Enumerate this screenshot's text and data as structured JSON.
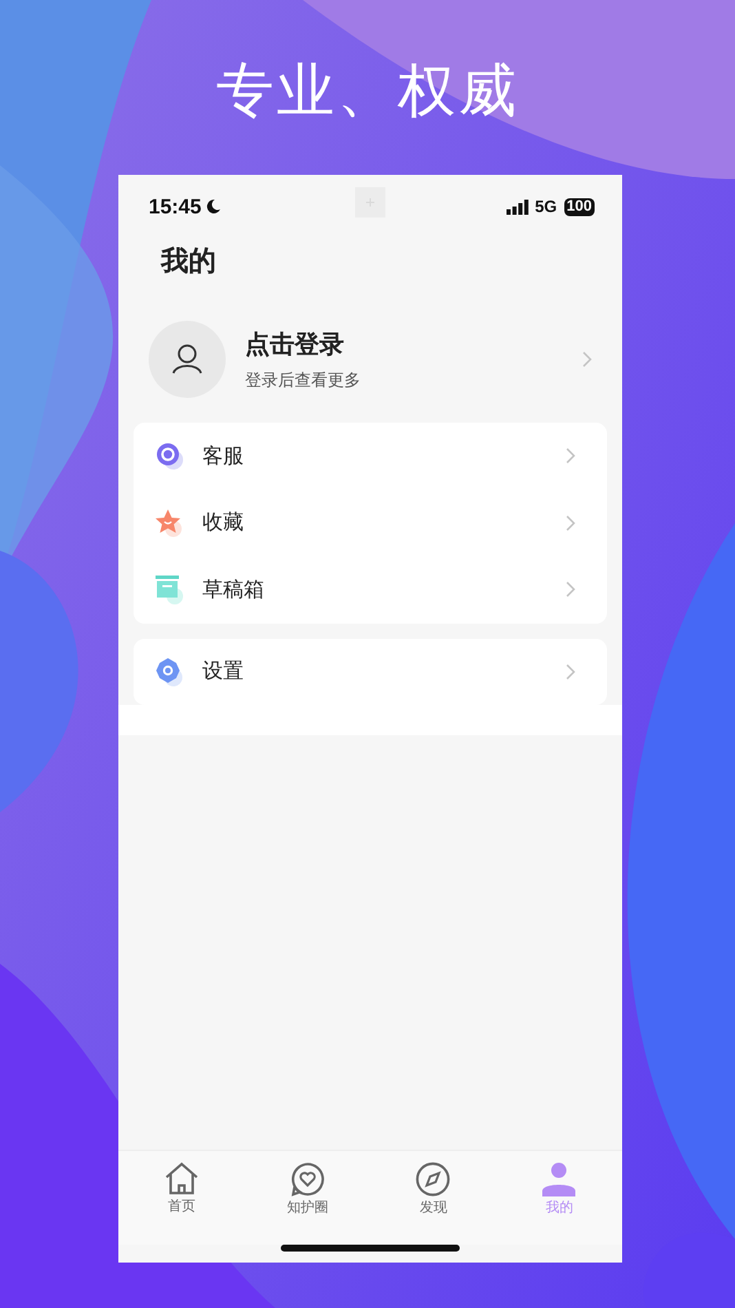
{
  "headline": "专业、权威",
  "status_bar": {
    "time": "15:45",
    "network": "5G",
    "battery": "100"
  },
  "page_title": "我的",
  "profile": {
    "title": "点击登录",
    "subtitle": "登录后查看更多"
  },
  "menu_groups": [
    [
      {
        "label": "客服",
        "kind": "service"
      },
      {
        "label": "收藏",
        "kind": "favorite"
      },
      {
        "label": "草稿箱",
        "kind": "drafts"
      }
    ],
    [
      {
        "label": "设置",
        "kind": "settings"
      }
    ]
  ],
  "tabs": [
    {
      "label": "首页",
      "kind": "home",
      "selected": false
    },
    {
      "label": "知护圈",
      "kind": "circle",
      "selected": false
    },
    {
      "label": "发现",
      "kind": "discover",
      "selected": false
    },
    {
      "label": "我的",
      "kind": "me",
      "selected": true
    }
  ]
}
